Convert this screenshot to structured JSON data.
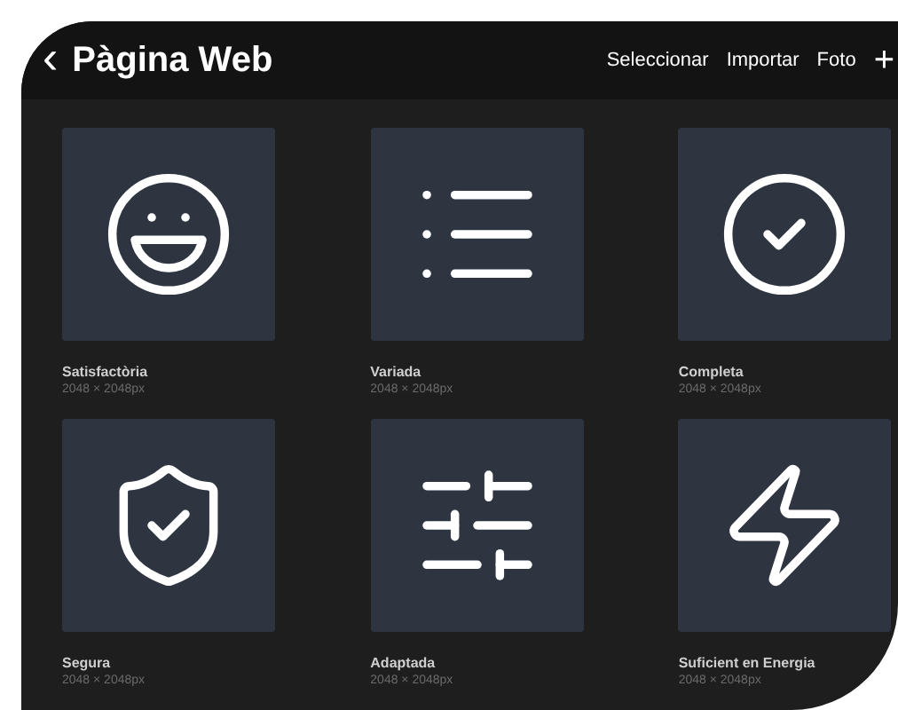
{
  "header": {
    "back": "‹",
    "title": "Pàgina Web",
    "actions": [
      "Seleccionar",
      "Importar",
      "Foto"
    ],
    "add": "+"
  },
  "items": [
    {
      "kind": "smile",
      "title": "Satisfactòria",
      "size": "2048 × 2048px"
    },
    {
      "kind": "list",
      "title": "Variada",
      "size": "2048 × 2048px"
    },
    {
      "kind": "check",
      "title": "Completa",
      "size": "2048 × 2048px"
    },
    {
      "kind": "shield",
      "title": "Segura",
      "size": "2048 × 2048px"
    },
    {
      "kind": "sliders",
      "title": "Adaptada",
      "size": "2048 × 2048px"
    },
    {
      "kind": "bolt",
      "title": "Suficient en Energia",
      "size": "2048 × 2048px"
    }
  ]
}
